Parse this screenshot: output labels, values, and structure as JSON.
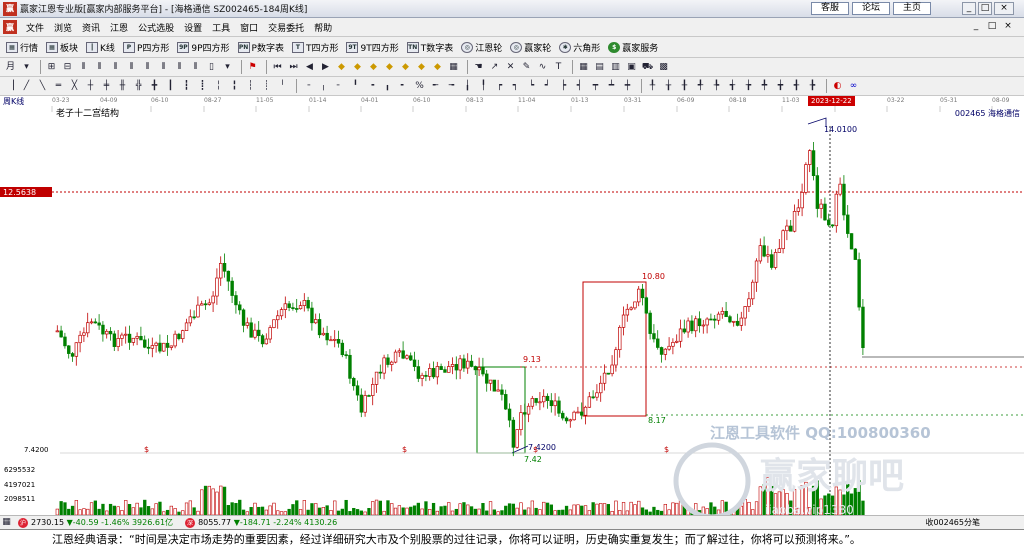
{
  "window": {
    "title": "赢家江恩专业版[赢家内部服务平台] - [海格通信  SZ002465-184周K线]",
    "links": [
      "客服",
      "论坛",
      "主页"
    ],
    "controls": [
      "_",
      "□",
      "×"
    ],
    "mdi_controls": [
      "_",
      "□",
      "×"
    ]
  },
  "menu": [
    "文件",
    "浏览",
    "资讯",
    "江恩",
    "公式选股",
    "设置",
    "工具",
    "窗口",
    "交易委托",
    "帮助"
  ],
  "toolbar1": [
    {
      "icon": "grid",
      "label": "行情"
    },
    {
      "icon": "grid",
      "label": "板块"
    },
    {
      "icon": "bars",
      "label": "K线"
    },
    {
      "icon": "P",
      "label": "P四方形"
    },
    {
      "icon": "9P",
      "label": "9P四方形"
    },
    {
      "icon": "PN",
      "label": "P数字表"
    },
    {
      "icon": "T",
      "label": "T四方形"
    },
    {
      "icon": "9T",
      "label": "9T四方形"
    },
    {
      "icon": "TN",
      "label": "T数字表"
    },
    {
      "icon": "wheel",
      "label": "江恩轮"
    },
    {
      "icon": "wheel",
      "label": "赢家轮"
    },
    {
      "icon": "hex",
      "label": "六角形"
    },
    {
      "icon": "$",
      "label": "赢家服务"
    }
  ],
  "dates": [
    "03-23",
    "04-09",
    "06-10",
    "08-27",
    "11-05",
    "01-14",
    "04-01",
    "06-10",
    "08-13",
    "11-04",
    "01-13",
    "03-31",
    "06-09",
    "08-18",
    "11-03",
    "03-22",
    "05-31",
    "08-09"
  ],
  "current_date": "2023-12-22",
  "chart_header": {
    "period": "周K线",
    "study_name": "老子十二宫结构",
    "stock": "002465  海格通信"
  },
  "chart": {
    "price_tag": "12.5638",
    "low_label_left": "7.4200",
    "high_label": "14.0100",
    "low_label": "7.4200",
    "low_small": "7.42",
    "level_913": "9.13",
    "level_1080": "10.80",
    "level_817": "8.17",
    "dollar_mark": "$",
    "volume_ticks": [
      "6295532",
      "4197021",
      "2098511"
    ],
    "watermark": "江恩工具软件  QQ:100800360",
    "brand_watermark": "赢家聊吧",
    "brand_sub": "iiaoba.vip1380"
  },
  "colors": {
    "up": "#c00000",
    "down": "#008000",
    "accent": "#c00000"
  },
  "status": {
    "index1_code": "沪",
    "index1": "2730.15",
    "index1_chg": "▼-40.59 -1.46% 3926.61亿",
    "index2_code": "深",
    "index2": "8055.77",
    "index2_chg": "▼-184.71 -2.24% 4130.26",
    "right": "收002465分笔"
  },
  "quote": "江恩经典语录：“时间是决定市场走势的重要因素，经过详细研究大市及个别股票的过往记录，你将可以证明，历史确实重复发生；而了解过往，你将可以预测将来。”。"
}
